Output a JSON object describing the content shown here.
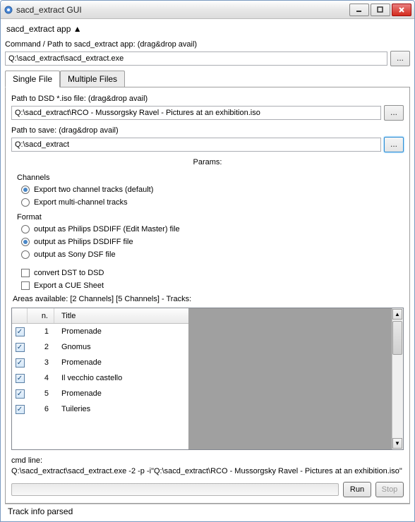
{
  "window": {
    "title": "sacd_extract GUI"
  },
  "header": {
    "appLabel": "sacd_extract app  ▲"
  },
  "command": {
    "label": "Command / Path to sacd_extract app: (drag&drop avail)",
    "value": "Q:\\sacd_extract\\sacd_extract.exe",
    "browse": "..."
  },
  "tabs": {
    "single": "Single File",
    "multiple": "Multiple Files"
  },
  "iso": {
    "label": "Path to DSD *.iso file: (drag&drop avail)",
    "value": "Q:\\sacd_extract\\RCO - Mussorgsky Ravel - Pictures at an exhibition.iso",
    "browse": "..."
  },
  "save": {
    "label": "Path to save: (drag&drop avail)",
    "value": "Q:\\sacd_extract",
    "browse": "..."
  },
  "params": {
    "heading": "Params:",
    "channelsHeading": "Channels",
    "channelOptions": [
      "Export two channel tracks (default)",
      "Export multi-channel tracks"
    ],
    "channelSelected": 0,
    "formatHeading": "Format",
    "formatOptions": [
      "output as Philips DSDIFF (Edit Master) file",
      "output as Philips DSDIFF file",
      "output as Sony DSF file"
    ],
    "formatSelected": 1,
    "convertDST": "convert DST to DSD",
    "exportCue": "Export a CUE Sheet"
  },
  "areas": {
    "label": "Areas available: [2 Channels] [5 Channels] - Tracks:",
    "cols": {
      "n": "n.",
      "title": "Title"
    },
    "tracks": [
      {
        "n": 1,
        "title": "Promenade",
        "checked": true
      },
      {
        "n": 2,
        "title": "Gnomus",
        "checked": true
      },
      {
        "n": 3,
        "title": "Promenade",
        "checked": true
      },
      {
        "n": 4,
        "title": "Il vecchio castello",
        "checked": true
      },
      {
        "n": 5,
        "title": "Promenade",
        "checked": true
      },
      {
        "n": 6,
        "title": "Tuileries",
        "checked": true
      }
    ]
  },
  "cmdline": {
    "label": "cmd line:",
    "value": "Q:\\sacd_extract\\sacd_extract.exe -2 -p  -i\"Q:\\sacd_extract\\RCO - Mussorgsky Ravel - Pictures at an exhibition.iso\""
  },
  "buttons": {
    "run": "Run",
    "stop": "Stop"
  },
  "status": "Track info parsed"
}
